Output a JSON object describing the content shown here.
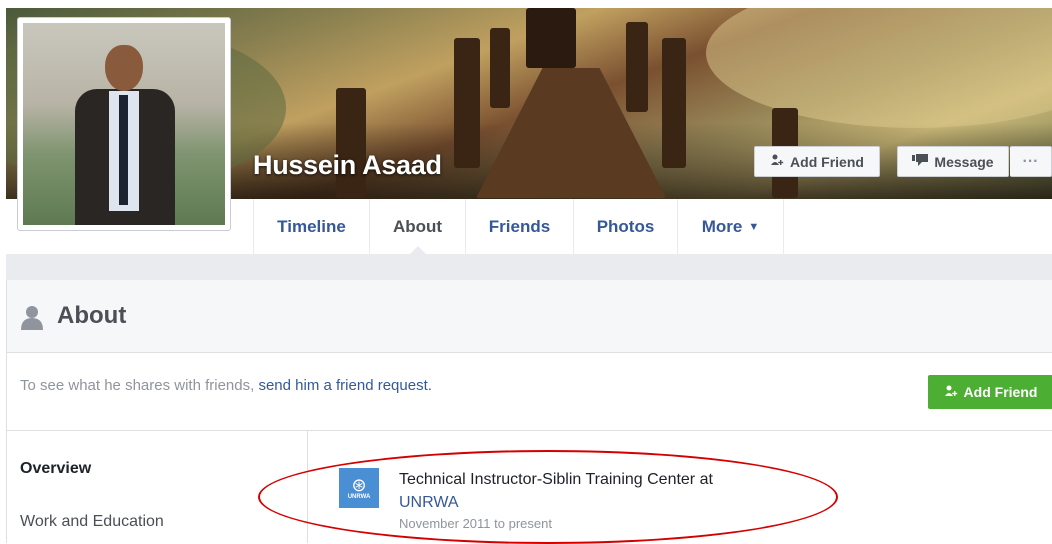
{
  "profile": {
    "name": "Hussein Asaad"
  },
  "header_buttons": {
    "add_friend": "Add Friend",
    "message": "Message",
    "more": "···"
  },
  "tabs": [
    {
      "label": "Timeline",
      "active": false
    },
    {
      "label": "About",
      "active": true
    },
    {
      "label": "Friends",
      "active": false
    },
    {
      "label": "Photos",
      "active": false
    },
    {
      "label": "More",
      "active": false
    }
  ],
  "about": {
    "title": "About",
    "notice_prefix": "To see what he shares with friends, ",
    "notice_link": "send him a friend request.",
    "add_friend_button": "Add Friend"
  },
  "sidenav": {
    "overview": "Overview",
    "work_education": "Work and Education"
  },
  "work": {
    "title": "Technical Instructor-Siblin Training Center at",
    "organization": "UNRWA",
    "period": "November 2011 to present",
    "logo_text": "UNRWA"
  },
  "colors": {
    "link": "#365899",
    "green": "#4cae33",
    "annotation": "#d40000"
  }
}
